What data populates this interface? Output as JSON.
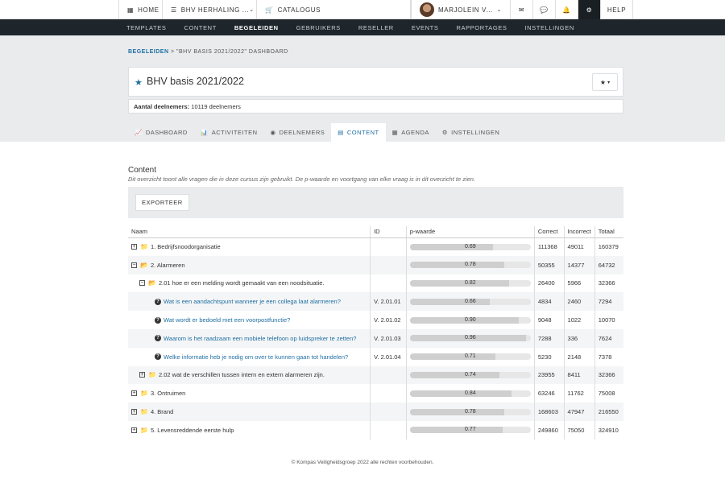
{
  "topbar": {
    "home_label": "HOME",
    "course_label": "BHV HERHALING ...",
    "catalog_label": "CATALOGUS",
    "user_name": "MARJOLEIN VA...",
    "help_label": "HELP"
  },
  "nav": [
    "TEMPLATES",
    "CONTENT",
    "BEGELEIDEN",
    "GEBRUIKERS",
    "RESELLER",
    "EVENTS",
    "RAPPORTAGES",
    "INSTELLINGEN"
  ],
  "breadcrumb": {
    "link": "BEGELEIDEN",
    "rest": " > \"BHV BASIS 2021/2022\" DASHBOARD"
  },
  "page_title": "BHV basis 2021/2022",
  "participants": {
    "label": "Aantal deelnemers:",
    "value": "10119 deelnemers"
  },
  "tabs": [
    "DASHBOARD",
    "ACTIVITEITEN",
    "DEELNEMERS",
    "CONTENT",
    "AGENDA",
    "INSTELLINGEN"
  ],
  "section": {
    "title": "Content",
    "description": "Dit overzicht toont alle vragen die in deze cursus zijn gebruikt. De p-waarde en voortgang van elke vraag is in dit overzicht te zien.",
    "export_label": "EXPORTEER"
  },
  "table": {
    "headers": {
      "name": "Naam",
      "id": "ID",
      "p": "p-waarde",
      "correct": "Correct",
      "incorrect": "Incorrect",
      "total": "Totaal"
    },
    "rows": [
      {
        "name": "1. Bedrijfsnoodorganisatie",
        "id": "",
        "p": 0.69,
        "p_label": "0.69",
        "correct": "111368",
        "incorrect": "49011",
        "total": "160379"
      },
      {
        "name": "2. Alarmeren",
        "id": "",
        "p": 0.78,
        "p_label": "0.78",
        "correct": "50355",
        "incorrect": "14377",
        "total": "64732"
      },
      {
        "name": "2.01 hoe er een melding wordt gemaakt van een noodsituatie.",
        "id": "",
        "p": 0.82,
        "p_label": "0.82",
        "correct": "26400",
        "incorrect": "5966",
        "total": "32366"
      },
      {
        "name": "Wat is een aandachtspunt wanneer je een collega laat alarmeren?",
        "id": "V. 2.01.01",
        "p": 0.66,
        "p_label": "0.66",
        "correct": "4834",
        "incorrect": "2460",
        "total": "7294"
      },
      {
        "name": "Wat wordt er bedoeld met een voorpostfunctie?",
        "id": "V. 2.01.02",
        "p": 0.9,
        "p_label": "0.90",
        "correct": "9048",
        "incorrect": "1022",
        "total": "10070"
      },
      {
        "name": "Waarom is het raadzaam een mobiele telefoon op luidspreker te zetten?",
        "id": "V. 2.01.03",
        "p": 0.96,
        "p_label": "0.96",
        "correct": "7288",
        "incorrect": "336",
        "total": "7624"
      },
      {
        "name": "Welke informatie heb je nodig om over te kunnen gaan tot handelen?",
        "id": "V. 2.01.04",
        "p": 0.71,
        "p_label": "0.71",
        "correct": "5230",
        "incorrect": "2148",
        "total": "7378"
      },
      {
        "name": "2.02 wat de verschillen tussen intern en extern alarmeren zijn.",
        "id": "",
        "p": 0.74,
        "p_label": "0.74",
        "correct": "23955",
        "incorrect": "8411",
        "total": "32366"
      },
      {
        "name": "3. Ontruimen",
        "id": "",
        "p": 0.84,
        "p_label": "0.84",
        "correct": "63246",
        "incorrect": "11762",
        "total": "75008"
      },
      {
        "name": "4. Brand",
        "id": "",
        "p": 0.78,
        "p_label": "0.78",
        "correct": "168603",
        "incorrect": "47947",
        "total": "216550"
      },
      {
        "name": "5. Levensreddende eerste hulp",
        "id": "",
        "p": 0.77,
        "p_label": "0.77",
        "correct": "249860",
        "incorrect": "75050",
        "total": "324910"
      }
    ]
  },
  "footer": "© Kompas Veiligheidsgroep 2022 alle rechten voorbehouden.",
  "colors": {
    "accent": "#1f6fa3",
    "dark_nav": "#1e252b",
    "gray_bg": "#e9ebed"
  }
}
